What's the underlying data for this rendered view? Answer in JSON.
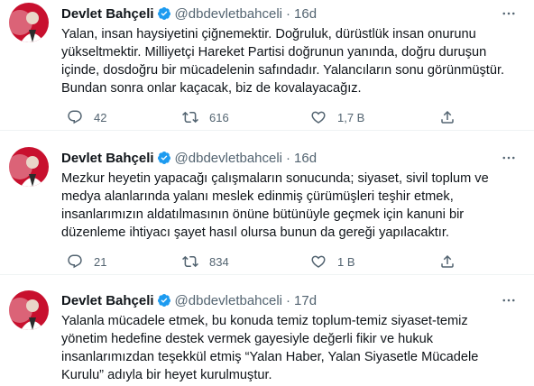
{
  "tweets": [
    {
      "name": "Devlet Bahçeli",
      "handle": "@dbdevletbahceli",
      "dot": "·",
      "time": "16d",
      "lines": [
        "Yalan, insan haysiyetini çiğnemektir. Doğruluk, dürüstlük insan onurunu",
        "yükseltmektir. Milliyetçi Hareket Partisi doğrunun yanında, doğru duruşun",
        "içinde, dosdoğru bir mücadelenin safındadır. Yalancıların sonu görünmüştür.",
        "Bundan sonra onlar kaçacak, biz de kovalayacağız."
      ],
      "replies": "42",
      "retweets": "616",
      "likes": "1,7 B"
    },
    {
      "name": "Devlet Bahçeli",
      "handle": "@dbdevletbahceli",
      "dot": "·",
      "time": "16d",
      "lines": [
        "Mezkur heyetin yapacağı çalışmaların sonucunda; siyaset, sivil toplum ve",
        "medya alanlarında yalanı meslek edinmiş çürümüşleri teşhir etmek,",
        "insanlarımızın aldatılmasının önüne bütünüyle geçmek için kanuni bir",
        "düzenleme ihtiyacı şayet hasıl olursa bunun da gereği yapılacaktır."
      ],
      "replies": "21",
      "retweets": "834",
      "likes": "1 B"
    },
    {
      "name": "Devlet Bahçeli",
      "handle": "@dbdevletbahceli",
      "dot": "·",
      "time": "17d",
      "lines": [
        "Yalanla mücadele etmek, bu konuda temiz toplum-temiz siyaset-temiz",
        "yönetim hedefine destek vermek gayesiyle değerli fikir ve hukuk",
        "insanlarımızdan teşekkül etmiş “Yalan Haber, Yalan Siyasetle Mücadele",
        "Kurulu” adıyla bir heyet kurulmuştur."
      ]
    }
  ],
  "icons": {
    "avatar": "avatar",
    "verified": "verified-badge-icon",
    "more": "more-options-icon",
    "reply": "reply-icon",
    "retweet": "retweet-icon",
    "like": "like-icon",
    "share": "share-icon"
  },
  "colors": {
    "verified": "#1d9bf0",
    "secondary_text": "#536471",
    "avatar_bg": "#c8102e"
  }
}
